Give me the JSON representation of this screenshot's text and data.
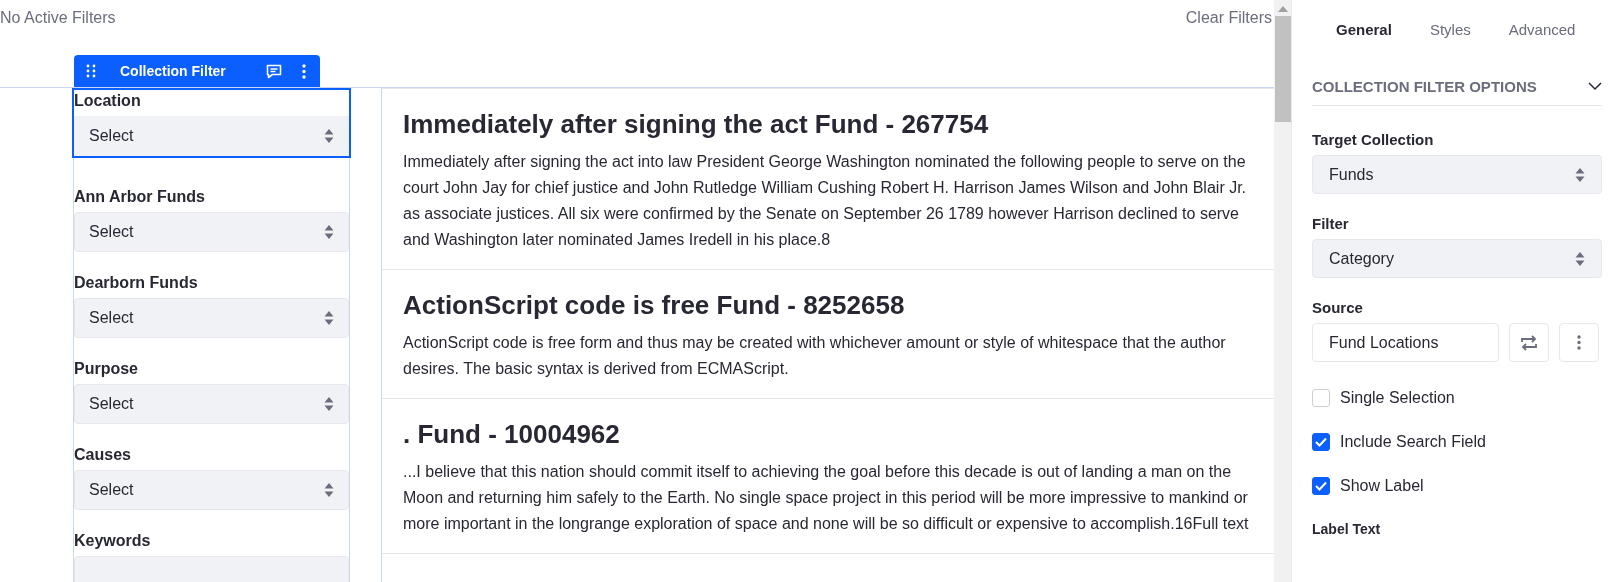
{
  "top_bar": {
    "status": "No Active Filters",
    "clear_link": "Clear Filters"
  },
  "fragment_toolbar": {
    "title": "Collection Filter"
  },
  "filters": [
    {
      "kind": "select",
      "label": "Location",
      "value": "Select",
      "selected": true
    },
    {
      "kind": "select",
      "label": "Ann Arbor Funds",
      "value": "Select",
      "selected": false
    },
    {
      "kind": "select",
      "label": "Dearborn Funds",
      "value": "Select",
      "selected": false
    },
    {
      "kind": "select",
      "label": "Purpose",
      "value": "Select",
      "selected": false
    },
    {
      "kind": "select",
      "label": "Causes",
      "value": "Select",
      "selected": false
    },
    {
      "kind": "search",
      "label": "Keywords",
      "selected": false
    }
  ],
  "results": [
    {
      "title": "Immediately after signing the act Fund - 267754",
      "text": "Immediately after signing the act into law President George Washington nominated the following people to serve on the court John Jay for chief justice and John Rutledge William Cushing Robert H. Harrison James Wilson and John Blair Jr. as associate justices. All six were confirmed by the Senate on September 26 1789 however Harrison declined to serve and Washington later nominated James Iredell in his place.8"
    },
    {
      "title": "ActionScript code is free Fund - 8252658",
      "text": "ActionScript code is free form and thus may be created with whichever amount or style of whitespace that the author desires. The basic syntax is derived from ECMAScript."
    },
    {
      "title": ". Fund - 10004962",
      "text": "...I believe that this nation should commit itself to achieving the goal before this decade is out of landing a man on the Moon and returning him safely to the Earth. No single space project in this period will be more impressive to mankind or more important in the longrange exploration of space and none will be so difficult or expensive to accomplish.16Full text"
    }
  ],
  "panel": {
    "tabs": [
      {
        "label": "General",
        "selected": true
      },
      {
        "label": "Styles",
        "selected": false
      },
      {
        "label": "Advanced",
        "selected": false
      }
    ],
    "section": {
      "title": "COLLECTION FILTER OPTIONS",
      "expanded": true
    },
    "target_collection": {
      "label": "Target Collection",
      "value": "Funds"
    },
    "filter": {
      "label": "Filter",
      "value": "Category"
    },
    "source": {
      "label": "Source",
      "value": "Fund Locations"
    },
    "options": [
      {
        "label": "Single Selection",
        "checked": false
      },
      {
        "label": "Include Search Field",
        "checked": true
      },
      {
        "label": "Show Label",
        "checked": true
      }
    ],
    "label_text": {
      "label": "Label Text"
    }
  }
}
